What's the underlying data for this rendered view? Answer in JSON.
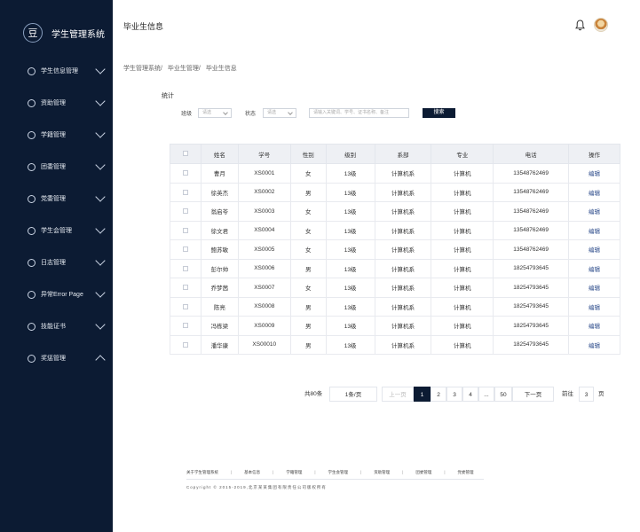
{
  "brand": {
    "logo_text": "豆",
    "title": "学生管理系统"
  },
  "sidebar": {
    "items": [
      {
        "label": "学生信息管理",
        "icon": "user-icon",
        "expanded": false
      },
      {
        "label": "资助管理",
        "icon": "money-icon",
        "expanded": false
      },
      {
        "label": "学籍管理",
        "icon": "book-icon",
        "expanded": false
      },
      {
        "label": "团委管理",
        "icon": "flag-icon",
        "expanded": false
      },
      {
        "label": "党委管理",
        "icon": "star-icon",
        "expanded": false
      },
      {
        "label": "学生会管理",
        "icon": "group-icon",
        "expanded": false
      },
      {
        "label": "日志管理",
        "icon": "calendar-icon",
        "expanded": false
      },
      {
        "label": "异常Error Page",
        "icon": "warning-icon",
        "expanded": false
      },
      {
        "label": "技能证书",
        "icon": "certificate-icon",
        "expanded": false
      },
      {
        "label": "奖惩管理",
        "icon": "award-icon",
        "expanded": true
      }
    ]
  },
  "header": {
    "title": "毕业生信息"
  },
  "breadcrumb": [
    "学生管理系统/",
    "毕业生管理/",
    "毕业生信息"
  ],
  "stat_label": "统计",
  "filters": {
    "class_label": "班级",
    "class_value": "请选",
    "status_label": "状态",
    "status_value": "请选",
    "search_placeholder": "请输入关键词、学号、证书名称、备注",
    "search_button": "搜索"
  },
  "table": {
    "headers": [
      "",
      "姓名",
      "学号",
      "性别",
      "级别",
      "系部",
      "专业",
      "电话",
      "操作"
    ],
    "rows": [
      [
        "曹月",
        "XS0001",
        "女",
        "13级",
        "计算机系",
        "计算机",
        "13548762469",
        "编辑"
      ],
      [
        "徐英杰",
        "XS0002",
        "男",
        "13级",
        "计算机系",
        "计算机",
        "13548762469",
        "编辑"
      ],
      [
        "翁启苓",
        "XS0003",
        "女",
        "13级",
        "计算机系",
        "计算机",
        "13548762469",
        "编辑"
      ],
      [
        "徐文君",
        "XS0004",
        "女",
        "13级",
        "计算机系",
        "计算机",
        "13548762469",
        "编辑"
      ],
      [
        "鲍苏敏",
        "XS0005",
        "女",
        "13级",
        "计算机系",
        "计算机",
        "13548762469",
        "编辑"
      ],
      [
        "彭尔帅",
        "XS0006",
        "男",
        "13级",
        "计算机系",
        "计算机",
        "18254793645",
        "编辑"
      ],
      [
        "乔梦茜",
        "XS0007",
        "女",
        "13级",
        "计算机系",
        "计算机",
        "18254793645",
        "编辑"
      ],
      [
        "陈亮",
        "XS0008",
        "男",
        "13级",
        "计算机系",
        "计算机",
        "18254793645",
        "编辑"
      ],
      [
        "冯栋梁",
        "XS0009",
        "男",
        "13级",
        "计算机系",
        "计算机",
        "18254793645",
        "编辑"
      ],
      [
        "潘华康",
        "XS00010",
        "男",
        "13级",
        "计算机系",
        "计算机",
        "18254793645",
        "编辑"
      ]
    ]
  },
  "pagination": {
    "total": "共80条",
    "page_size": "1条/页",
    "prev": "上一页",
    "pages": [
      "1",
      "2",
      "3",
      "4",
      "...",
      "50"
    ],
    "active_page": "1",
    "next": "下一页",
    "goto_label": "前往",
    "goto_value": "3",
    "goto_suffix": "页"
  },
  "footer": {
    "links": [
      "关于学生管理系统",
      "基本信息",
      "学籍管理",
      "学生会管理",
      "资助管理",
      "团委管理",
      "党委管理"
    ],
    "copyright": "Copyright © 2015-2019,北京某某集团有限责任公司版权所有"
  },
  "colors": {
    "sidebar_bg": "#0c1b33",
    "accent": "#0c1b33",
    "link": "#2b4a8a"
  }
}
